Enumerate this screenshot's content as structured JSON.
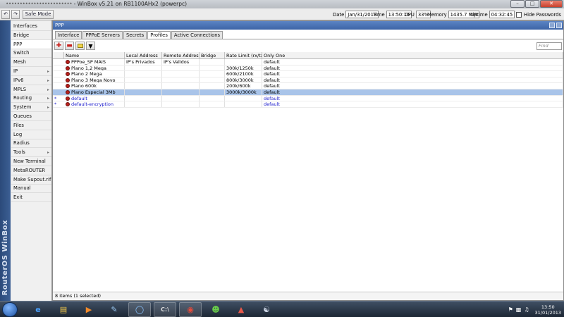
{
  "app": {
    "title_blurred": "••••••••••••••••••••••••",
    "title": "- WinBox v5.21 on RB1100AHx2 (powerpc)"
  },
  "toolbar": {
    "undo_icon": "undo-icon",
    "redo_icon": "redo-icon",
    "safe_mode_label": "Safe Mode",
    "date_label": "Date",
    "date_value": "Jan/31/2013",
    "time_label": "Time",
    "time_value": "13:50:16",
    "cpu_label": "CPU",
    "cpu_value": "33%",
    "memory_label": "Memory",
    "memory_value": "1435.7 MiB",
    "uptime_label": "Uptime",
    "uptime_value": "04:32:45",
    "hide_passwords_label": "Hide Passwords"
  },
  "sidebar": {
    "vertical_label": "RouterOS WinBox",
    "items": [
      {
        "label": "Interfaces",
        "submenu": false
      },
      {
        "label": "Bridge",
        "submenu": false
      },
      {
        "label": "PPP",
        "submenu": false,
        "active": true
      },
      {
        "label": "Switch",
        "submenu": false
      },
      {
        "label": "Mesh",
        "submenu": false
      },
      {
        "label": "IP",
        "submenu": true
      },
      {
        "label": "IPv6",
        "submenu": true
      },
      {
        "label": "MPLS",
        "submenu": true
      },
      {
        "label": "Routing",
        "submenu": true
      },
      {
        "label": "System",
        "submenu": true
      },
      {
        "label": "Queues",
        "submenu": false
      },
      {
        "label": "Files",
        "submenu": false
      },
      {
        "label": "Log",
        "submenu": false
      },
      {
        "label": "Radius",
        "submenu": false
      },
      {
        "label": "Tools",
        "submenu": true
      },
      {
        "label": "New Terminal",
        "submenu": false
      },
      {
        "label": "MetaROUTER",
        "submenu": false
      },
      {
        "label": "Make Supout.rif",
        "submenu": false
      },
      {
        "label": "Manual",
        "submenu": false
      },
      {
        "label": "Exit",
        "submenu": false
      }
    ]
  },
  "ppp_window": {
    "title": "PPP",
    "tabs": [
      "Interface",
      "PPPoE Servers",
      "Secrets",
      "Profiles",
      "Active Connections"
    ],
    "active_tab": "Profiles",
    "find_placeholder": "Find",
    "columns": [
      "Name",
      "Local Address",
      "Remote Address",
      "Bridge",
      "Rate Limit (rx/tx)",
      "Only One"
    ],
    "rows": [
      {
        "marker": "",
        "name": "PPPoe_SP MAIS",
        "local": "IP's Privados",
        "remote": "IP's Validos",
        "bridge": "",
        "rate": "",
        "only_one": "default",
        "selected": false,
        "is_default": false
      },
      {
        "marker": "",
        "name": "Plano 1,2 Mega",
        "local": "",
        "remote": "",
        "bridge": "",
        "rate": "300k/1250k",
        "only_one": "default",
        "selected": false,
        "is_default": false
      },
      {
        "marker": "",
        "name": "Plano 2 Mega",
        "local": "",
        "remote": "",
        "bridge": "",
        "rate": "600k/2100k",
        "only_one": "default",
        "selected": false,
        "is_default": false
      },
      {
        "marker": "",
        "name": "Plano 3 Mega Novo",
        "local": "",
        "remote": "",
        "bridge": "",
        "rate": "800k/3000k",
        "only_one": "default",
        "selected": false,
        "is_default": false
      },
      {
        "marker": "",
        "name": "Plano 600k",
        "local": "",
        "remote": "",
        "bridge": "",
        "rate": "200k/600k",
        "only_one": "default",
        "selected": false,
        "is_default": false
      },
      {
        "marker": "",
        "name": "Plano Especial 3Mb",
        "local": "",
        "remote": "",
        "bridge": "",
        "rate": "3000k/3000k",
        "only_one": "default",
        "selected": true,
        "is_default": false
      },
      {
        "marker": "*",
        "name": "default",
        "local": "",
        "remote": "",
        "bridge": "",
        "rate": "",
        "only_one": "default",
        "selected": false,
        "is_default": true
      },
      {
        "marker": "*",
        "name": "default-encryption",
        "local": "",
        "remote": "",
        "bridge": "",
        "rate": "",
        "only_one": "default",
        "selected": false,
        "is_default": true
      }
    ],
    "status_text": "8 items (1 selected)"
  },
  "taskbar": {
    "clock_time": "13:50",
    "clock_date": "31/01/2013",
    "apps": [
      "internet-explorer-icon",
      "file-explorer-icon",
      "media-player-icon",
      "paint-icon",
      "winbox-icon",
      "terminal-icon",
      "chrome-icon",
      "messenger-icon",
      "app-icon",
      "app2-icon"
    ]
  },
  "colors": {
    "accent": "#3d64a6",
    "selection": "#a9c4e9",
    "default_text": "#1a1acd"
  }
}
